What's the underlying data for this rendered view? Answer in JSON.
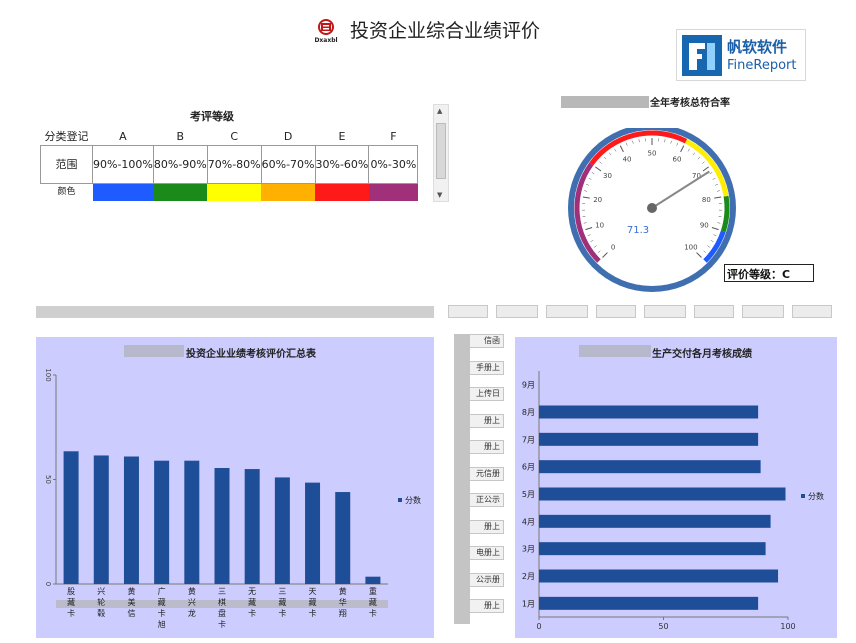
{
  "page": {
    "title": "投资企业综合业绩评价"
  },
  "brand": {
    "name_cn": "帆软软件",
    "name_en": "FineReport"
  },
  "header_logo": {
    "icon": "dongfang-logo-icon",
    "caption": "Dxaxbl"
  },
  "grade_table": {
    "title": "考评等级",
    "category_label": "分类登记",
    "range_label": "范围",
    "color_label": "颜色",
    "grades": [
      {
        "letter": "A",
        "range": "90%-100%",
        "color": "#1e5cff"
      },
      {
        "letter": "B",
        "range": "80%-90%",
        "color": "#1a8a1a"
      },
      {
        "letter": "C",
        "range": "70%-80%",
        "color": "#ffff00"
      },
      {
        "letter": "D",
        "range": "60%-70%",
        "color": "#ffb000"
      },
      {
        "letter": "E",
        "range": "30%-60%",
        "color": "#ff1a1a"
      },
      {
        "letter": "F",
        "range": "0%-30%",
        "color": "#a0307a"
      }
    ]
  },
  "gauge": {
    "title": "全年考核总符合率",
    "value": 71.3,
    "min": 0,
    "max": 100,
    "tick_labels": [
      "0",
      "10",
      "20",
      "30",
      "40",
      "50",
      "60",
      "70",
      "80",
      "90",
      "100"
    ],
    "colors": {
      "red": "#ff1a1a",
      "yellow": "#ffee00",
      "green": "#1a8a1a",
      "blue": "#1e5cff",
      "purple": "#a0307a",
      "bezel": "#3f6fb0",
      "needle": "#888888",
      "value_text": "#3a6fd0"
    },
    "rating_text": "评价等级：C"
  },
  "left_chart": {
    "chart_data": {
      "type": "bar",
      "title": "投资企业业绩考核评价汇总表",
      "categories": [
        "股",
        "兴",
        "黄",
        "广",
        "黄",
        "三",
        "无",
        "三",
        "天",
        "黄",
        "重"
      ],
      "category_lines": [
        [
          "股",
          "藏",
          "卡"
        ],
        [
          "兴",
          "轮",
          "毂"
        ],
        [
          "黄",
          "美",
          "信"
        ],
        [
          "广",
          "藏",
          "卡",
          "旭"
        ],
        [
          "黄",
          "兴",
          "龙"
        ],
        [
          "三",
          "棋",
          "盘",
          "卡"
        ],
        [
          "无",
          "藏",
          "卡"
        ],
        [
          "三",
          "藏",
          "卡"
        ],
        [
          "天",
          "藏",
          "卡"
        ],
        [
          "黄",
          "华",
          "翔"
        ],
        [
          "重",
          "藏",
          "卡"
        ]
      ],
      "series": [
        {
          "name": "分数",
          "values": [
            63.5,
            61.5,
            61,
            59,
            59,
            55.5,
            55,
            51,
            48.5,
            44,
            3.5
          ]
        }
      ],
      "ylim": [
        0,
        100
      ],
      "ytick_labels": [
        "0",
        "50",
        "100"
      ],
      "legend_position": "right",
      "bar_color": "#1f4e99"
    }
  },
  "right_chart": {
    "chart_data": {
      "type": "bar",
      "orientation": "horizontal",
      "title": "生产交付各月考核成绩",
      "categories": [
        "1月",
        "2月",
        "3月",
        "4月",
        "5月",
        "6月",
        "7月",
        "8月",
        "9月"
      ],
      "series": [
        {
          "name": "分数",
          "values": [
            88,
            96,
            91,
            93,
            99,
            89,
            88,
            88,
            0
          ]
        }
      ],
      "xlim": [
        0,
        100
      ],
      "xtick_labels": [
        "0",
        "50",
        "100"
      ],
      "legend_position": "right",
      "bar_color": "#1f4e99"
    }
  },
  "side_buttons": [
    "信函",
    "手册上",
    "上传日",
    "册上",
    "册上",
    "元信册",
    "正公示",
    "册上",
    "电册上",
    "公示册",
    "册上"
  ],
  "top_buttons": [
    "",
    "",
    "",
    "",
    "",
    "",
    "",
    ""
  ]
}
